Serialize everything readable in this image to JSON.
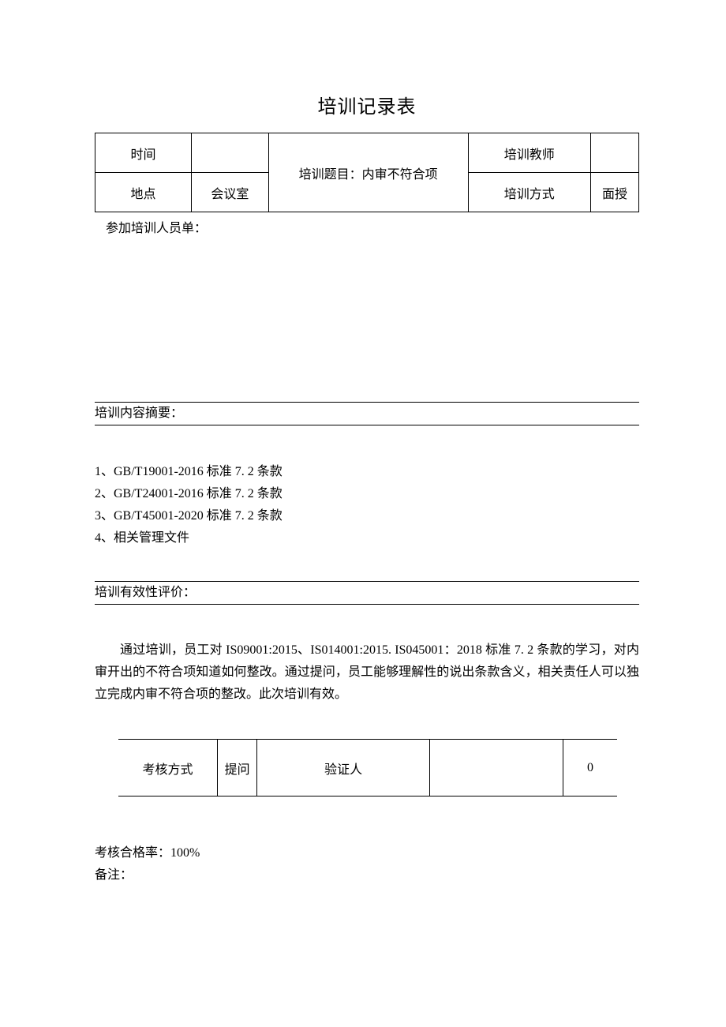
{
  "title": "培训记录表",
  "top": {
    "time_label": "时间",
    "time_value": "",
    "topic": "培训题目：内审不符合项",
    "teacher_label": "培训教师",
    "teacher_value": "",
    "place_label": "地点",
    "place_value": "会议室",
    "method_label": "培训方式",
    "method_value": "面授"
  },
  "attendee_label": "参加培训人员单：",
  "content_summary_header": "培训内容摘要：",
  "content_items": [
    "1、GB/T19001-2016 标准 7. 2 条款",
    "2、GB/T24001-2016 标准 7. 2 条款",
    "3、GB/T45001-2020 标准 7. 2 条款",
    "4、相关管理文件"
  ],
  "eval_header": "培训有效性评价：",
  "eval_text": "通过培训，员工对 IS09001:2015、IS014001:2015. IS045001：2018 标准 7. 2 条款的学习，对内审开出的不符合项知道如何整改。通过提问，员工能够理解性的说出条款含义，相关责任人可以独立完成内审不符合项的整改。此次培训有效。",
  "assess": {
    "method_label": "考核方式",
    "method_value": "提问",
    "verifier_label": "验证人",
    "verifier_value": "",
    "extra": "0"
  },
  "pass_rate": "考核合格率：100%",
  "remark": "备注："
}
